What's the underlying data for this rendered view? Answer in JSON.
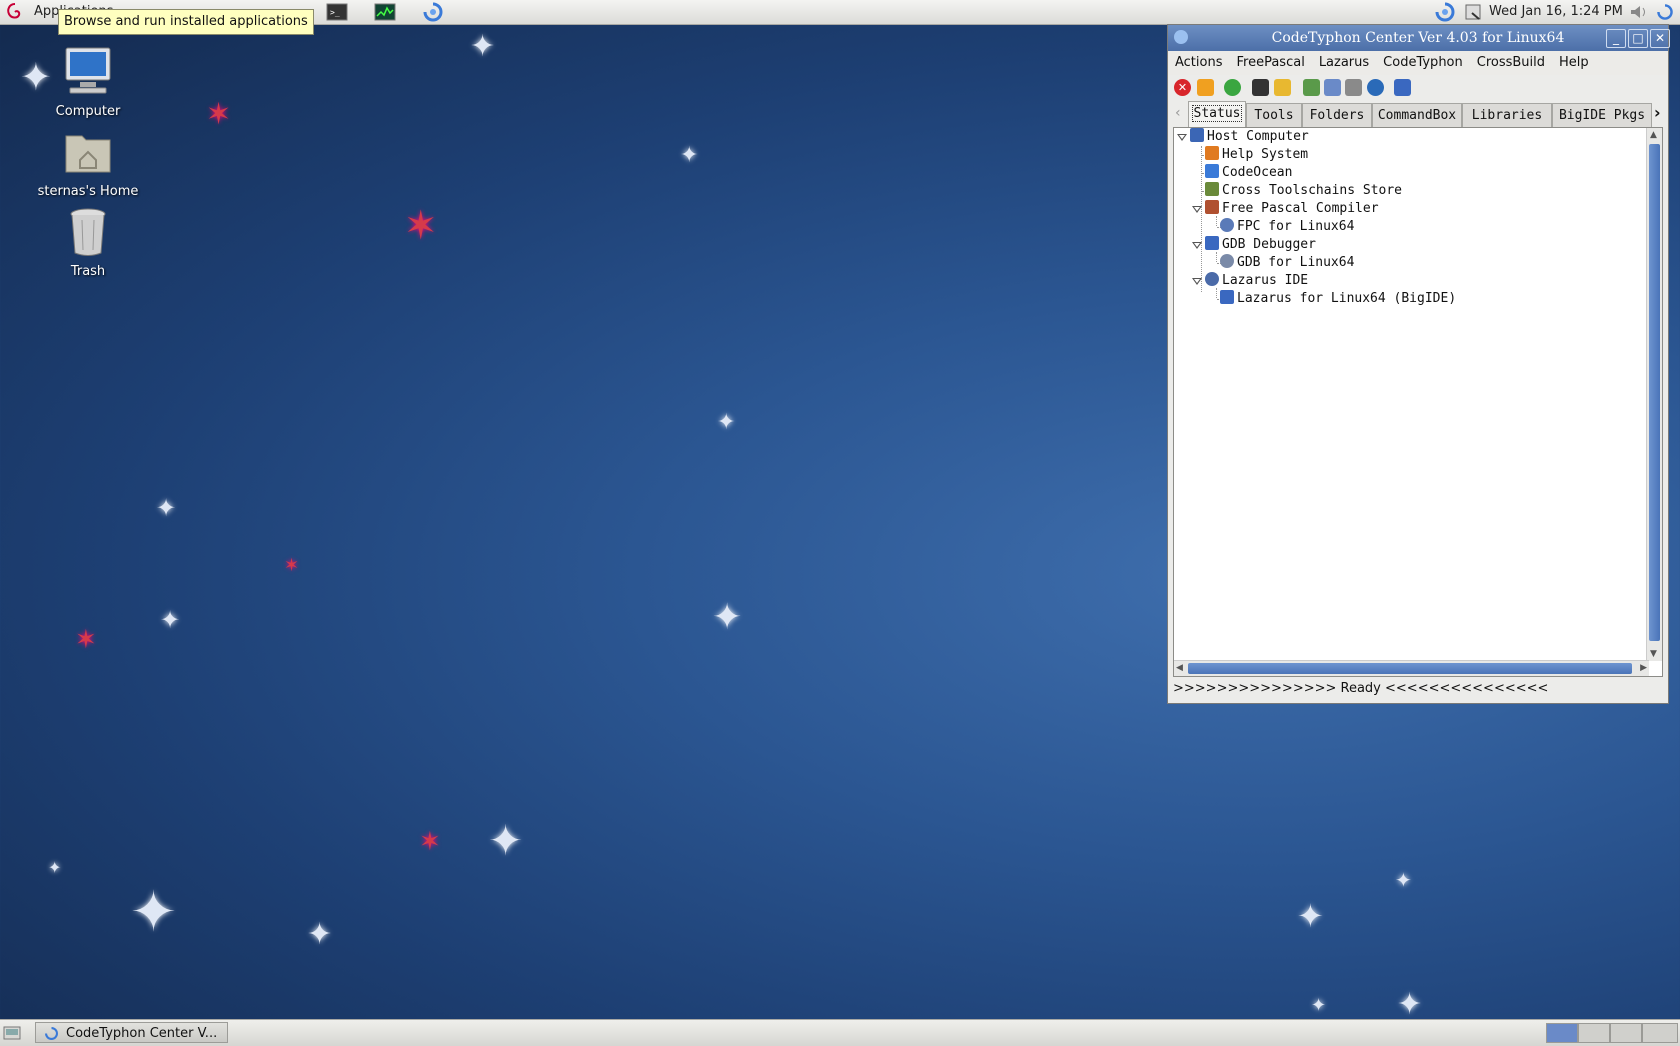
{
  "top_panel": {
    "applications_label": "Applications",
    "tooltip": "Browse and run installed applications",
    "clock": "Wed Jan 16,  1:24 PM",
    "icons": [
      "debian-logo-icon",
      "terminal-icon",
      "system-monitor-icon",
      "codetyphon-launcher-icon",
      "codetyphon-tray-icon",
      "search-tray-icon",
      "volume-icon"
    ]
  },
  "desktop": {
    "icons": [
      {
        "label": "Computer",
        "icon": "computer-icon"
      },
      {
        "label": "sternas's Home",
        "icon": "home-folder-icon"
      },
      {
        "label": "Trash",
        "icon": "trash-icon"
      }
    ]
  },
  "window": {
    "title": "CodeTyphon Center Ver 4.03 for Linux64",
    "menu": [
      "Actions",
      "FreePascal",
      "Lazarus",
      "CodeTyphon",
      "CrossBuild",
      "Help"
    ],
    "tabs": [
      "Status",
      "Tools",
      "Folders",
      "CommandBox",
      "Libraries",
      "BigIDE Pkgs"
    ],
    "active_tab": "Status",
    "tree": [
      {
        "label": "Host Computer",
        "level": 0,
        "expanded": true,
        "icon": "computer-icon"
      },
      {
        "label": "Help System",
        "level": 1,
        "icon": "help-icon"
      },
      {
        "label": "CodeOcean",
        "level": 1,
        "icon": "codeocean-icon"
      },
      {
        "label": "Cross Toolschains Store",
        "level": 1,
        "icon": "store-icon"
      },
      {
        "label": "Free Pascal Compiler",
        "level": 1,
        "expanded": true,
        "icon": "compiler-icon"
      },
      {
        "label": "FPC for Linux64",
        "level": 2,
        "icon": "gear-icon"
      },
      {
        "label": "GDB Debugger",
        "level": 1,
        "expanded": true,
        "icon": "debugger-icon"
      },
      {
        "label": "GDB for Linux64",
        "level": 2,
        "icon": "gear-icon"
      },
      {
        "label": "Lazarus IDE",
        "level": 1,
        "expanded": true,
        "icon": "lazarus-icon"
      },
      {
        "label": "Lazarus for Linux64 (BigIDE)",
        "level": 2,
        "icon": "bigide-icon"
      }
    ],
    "status": ">>>>>>>>>>>>>>> Ready <<<<<<<<<<<<<<<"
  },
  "taskbar": {
    "task_label": "CodeTyphon Center V...",
    "workspaces": 4
  },
  "colors": {
    "accent": "#4c6fa8",
    "desktop": "#2b5692",
    "tooltip": "#ffffbf"
  }
}
